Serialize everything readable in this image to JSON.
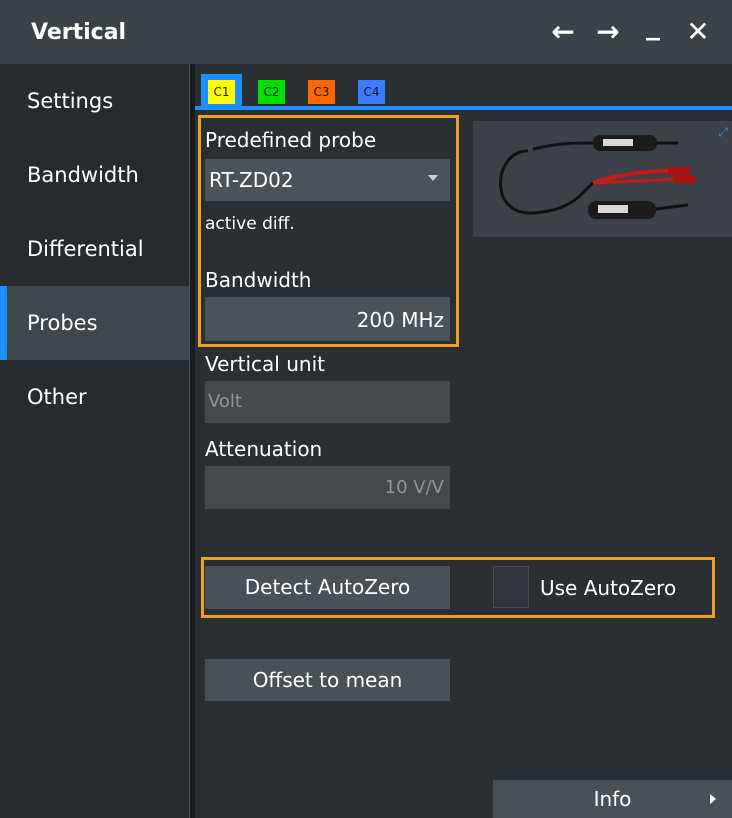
{
  "window": {
    "title": "Vertical",
    "back_icon": "arrow-left-icon",
    "forward_icon": "arrow-right-icon",
    "minimize_icon": "minimize-icon",
    "close_icon": "close-icon",
    "back_glyph": "←",
    "forward_glyph": "→",
    "minimize_glyph": "_",
    "close_glyph": "✕"
  },
  "sidebar": {
    "items": [
      {
        "label": "Settings"
      },
      {
        "label": "Bandwidth"
      },
      {
        "label": "Differential"
      },
      {
        "label": "Probes"
      },
      {
        "label": "Other"
      }
    ],
    "active": "Probes"
  },
  "tabs": [
    {
      "label": "C1",
      "color": "#ffff00"
    },
    {
      "label": "C2",
      "color": "#00e000"
    },
    {
      "label": "C3",
      "color": "#ff6600"
    },
    {
      "label": "C4",
      "color": "#3a7bff"
    }
  ],
  "probe": {
    "predefined_label": "Predefined probe",
    "predefined_value": "RT-ZD02",
    "type_text": "active diff.",
    "bandwidth_label": "Bandwidth",
    "bandwidth_value": "200 MHz",
    "vertical_unit_label": "Vertical unit",
    "vertical_unit_value": "Volt",
    "attenuation_label": "Attenuation",
    "attenuation_value": "10 V/V"
  },
  "autozero": {
    "detect_label": "Detect AutoZero",
    "use_label": "Use AutoZero",
    "use_checked": false
  },
  "actions": {
    "offset_label": "Offset to mean",
    "info_label": "Info"
  },
  "colors": {
    "accent": "#1f8fff",
    "highlight": "#f0a020"
  }
}
